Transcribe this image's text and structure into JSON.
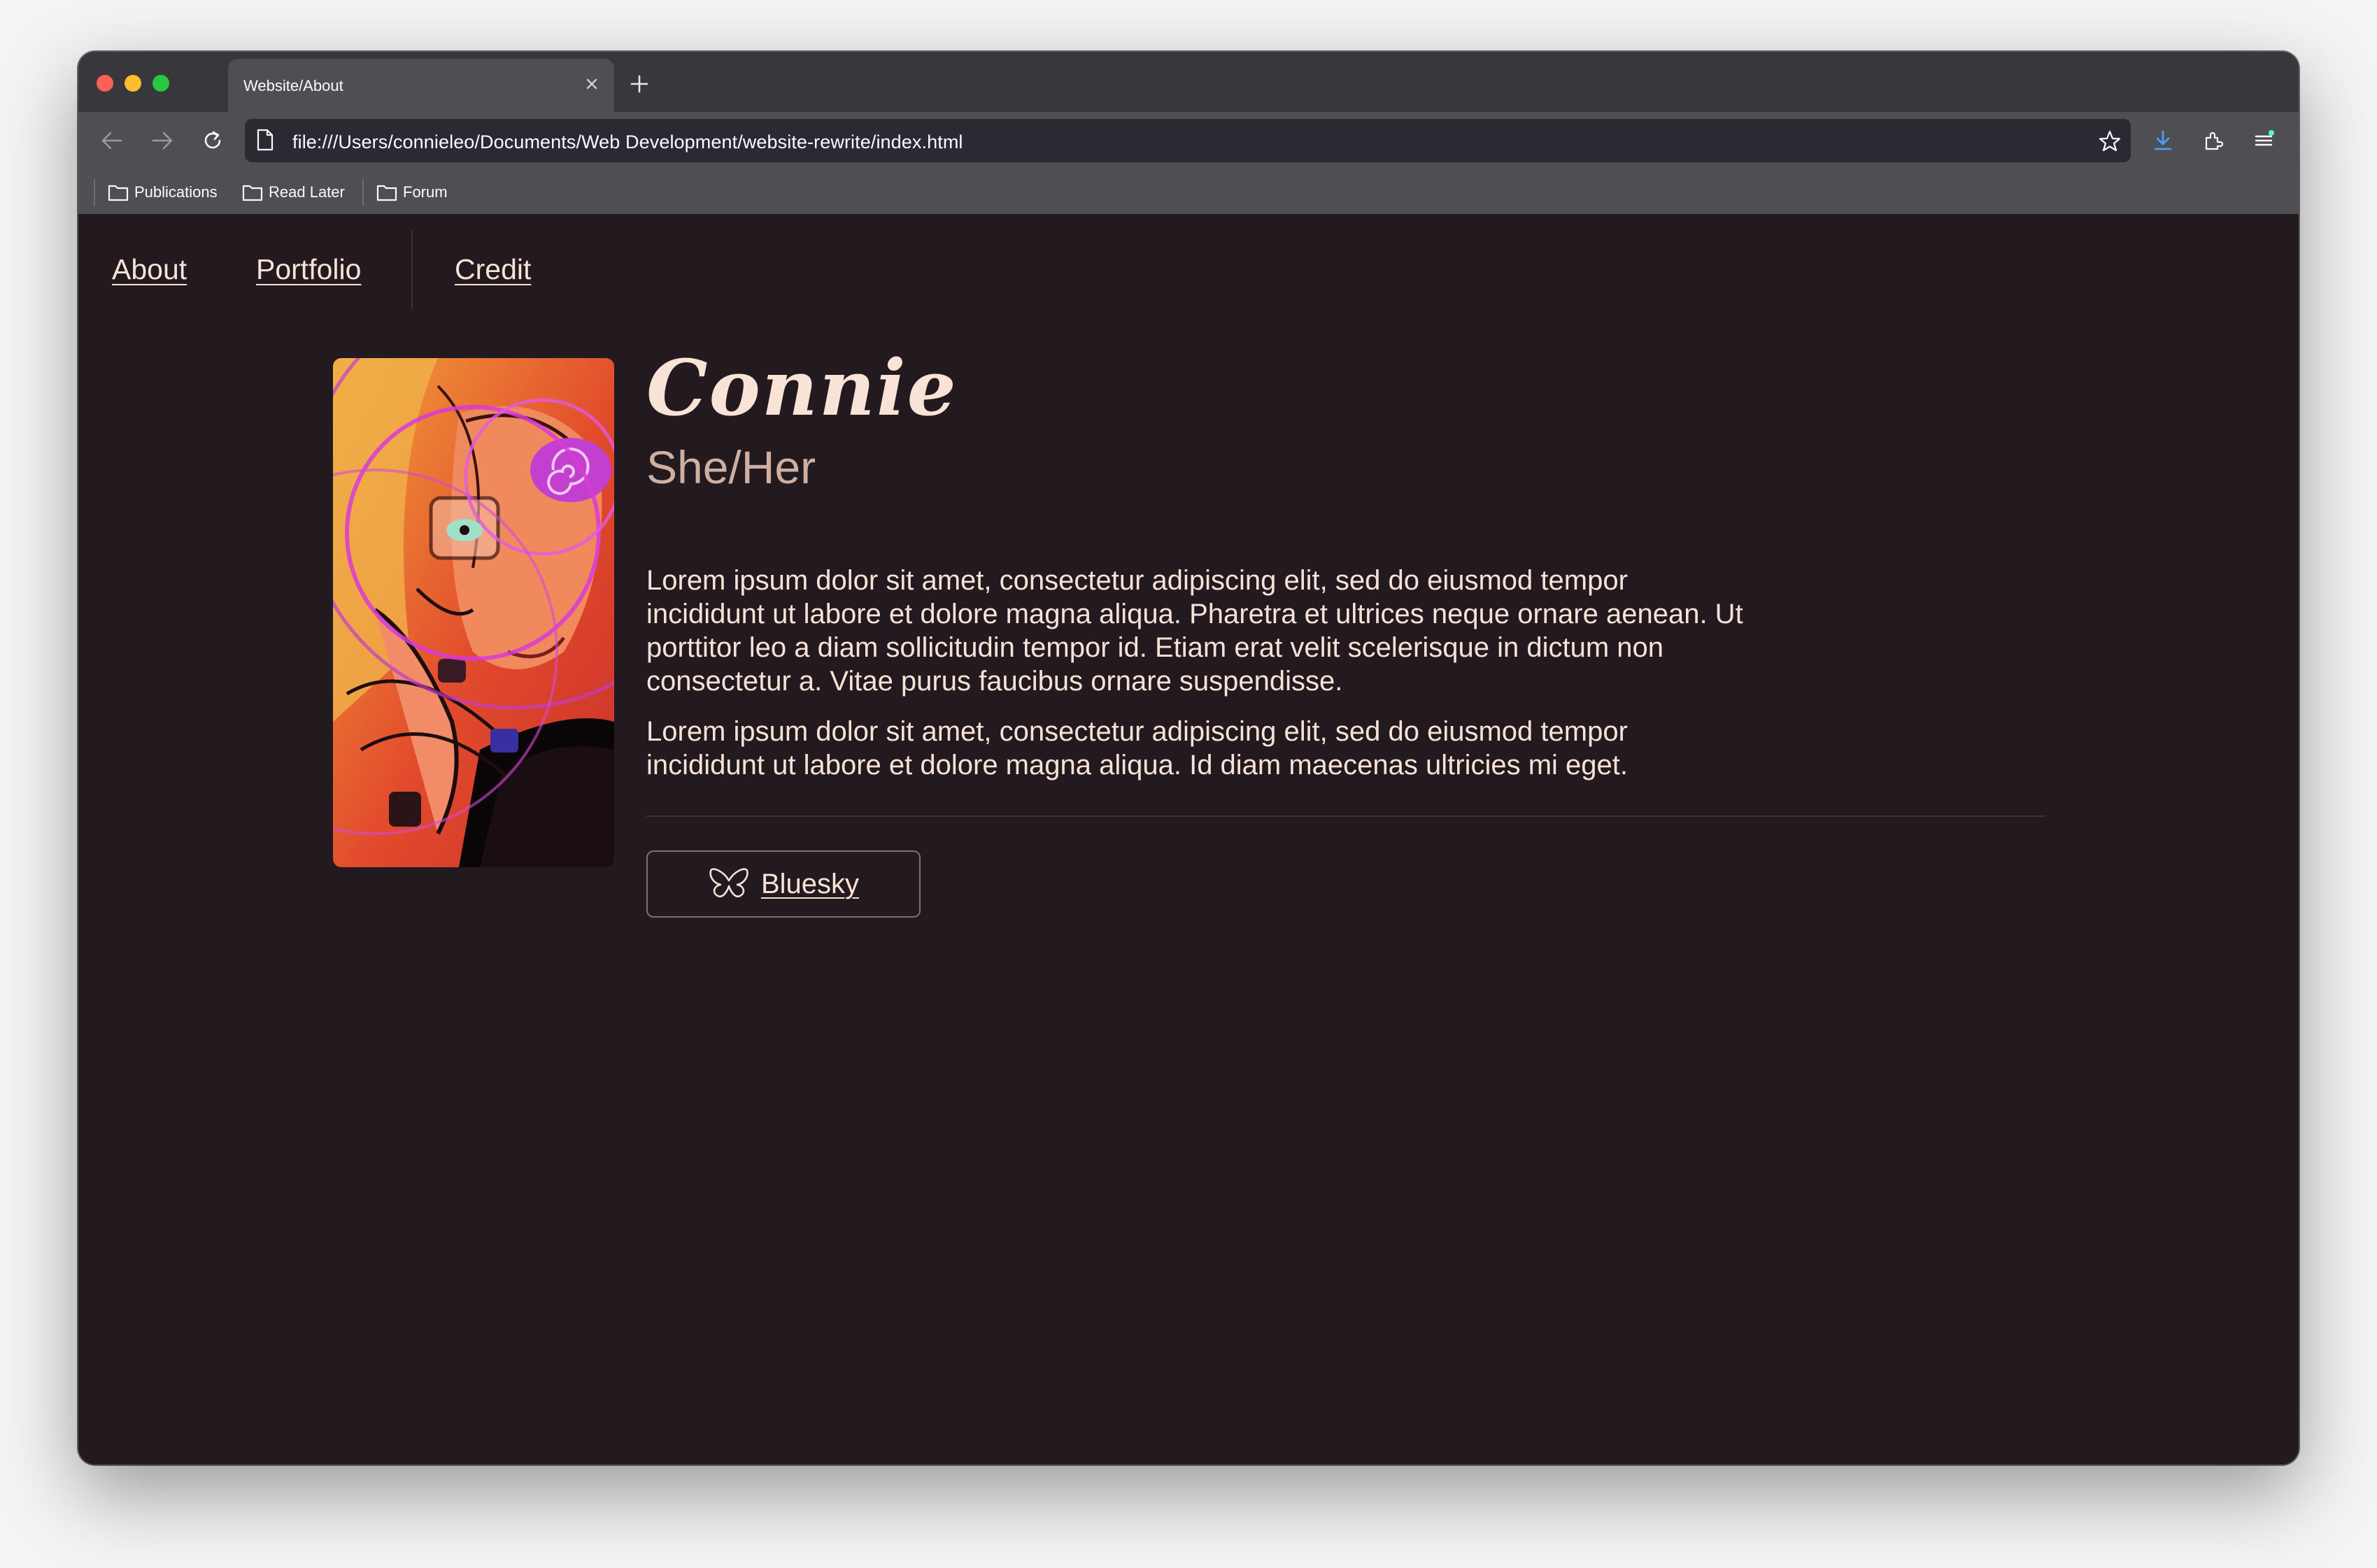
{
  "browser": {
    "tab_title": "Website/About",
    "url": "file:///Users/connieleo/Documents/Web Development/website-rewrite/index.html",
    "bookmarks": [
      {
        "label": "Publications",
        "icon": "folder-icon"
      },
      {
        "label": "Read Later",
        "icon": "folder-icon"
      },
      {
        "label": "Forum",
        "icon": "folder-icon"
      }
    ],
    "toolbar_icons": [
      "back-icon",
      "forward-icon",
      "reload-icon",
      "star-icon",
      "download-icon",
      "extensions-icon",
      "menu-icon"
    ]
  },
  "site": {
    "nav": [
      {
        "label": "About"
      },
      {
        "label": "Portfolio"
      },
      {
        "label": "Credit"
      }
    ],
    "profile": {
      "name": "Connie",
      "pronouns": "She/Her",
      "bio": [
        "Lorem ipsum dolor sit amet, consectetur adipiscing elit, sed do eiusmod tempor incididunt ut labore et dolore magna aliqua. Pharetra et ultrices neque ornare aenean. Ut porttitor leo a diam sollicitudin tempor id. Etiam erat velit scelerisque in dictum non consectetur a. Vitae purus faucibus ornare suspendisse.",
        "Lorem ipsum dolor sit amet, consectetur adipiscing elit, sed do eiusmod tempor incididunt ut labore et dolore magna aliqua. Id diam maecenas ultricies mi eget."
      ],
      "link_label": "Bluesky",
      "link_icon": "butterfly-icon"
    }
  },
  "colors": {
    "page_background": "#231a1f",
    "text": "#f6e2d6",
    "pronoun_text": "#cfb0a0",
    "accent_magenta": "#d93ad8",
    "browser_chrome": "#4f4e52"
  }
}
